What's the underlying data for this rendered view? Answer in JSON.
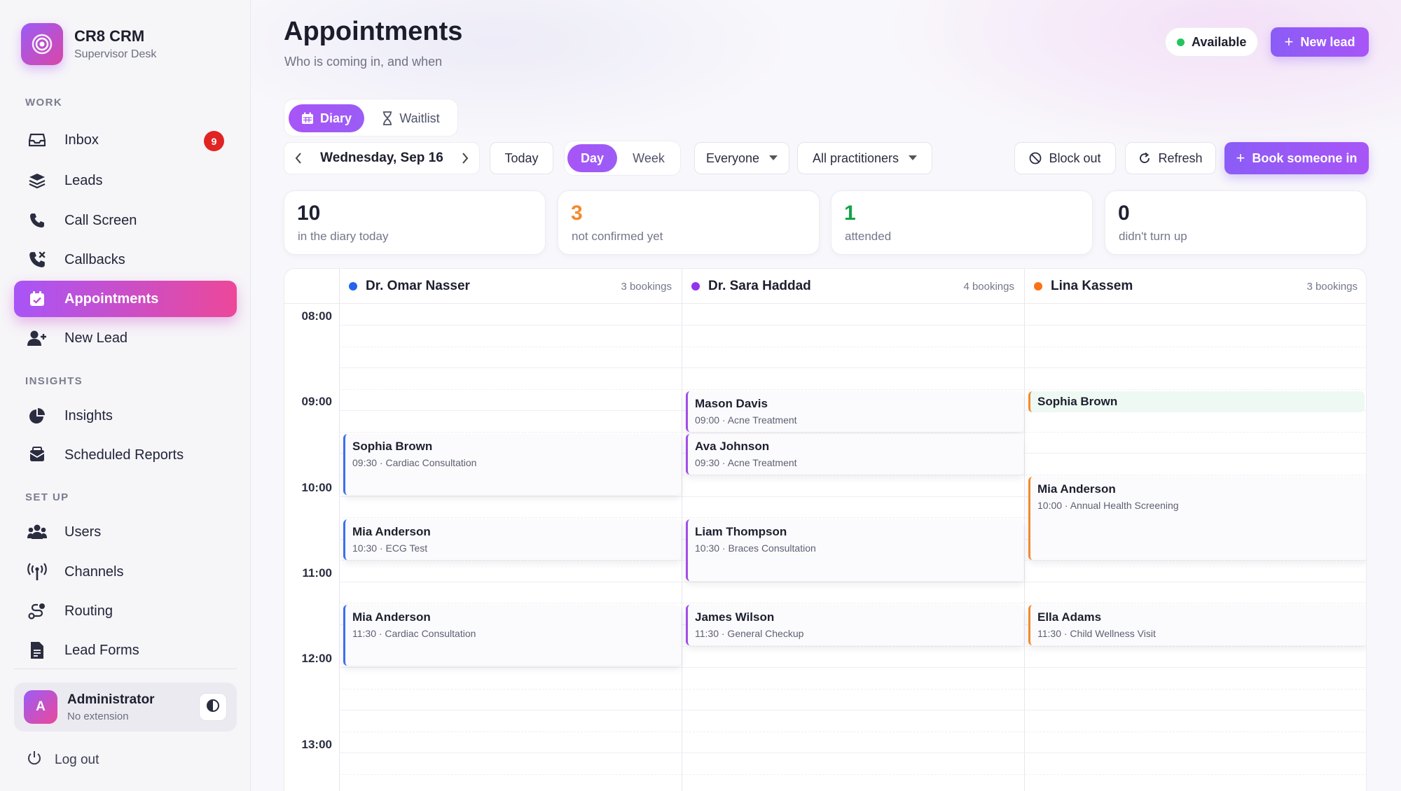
{
  "brand": {
    "name": "CR8 CRM",
    "subtitle": "Supervisor Desk"
  },
  "sidebar": {
    "sections": {
      "work": "WORK",
      "insights": "INSIGHTS",
      "setup": "SET UP"
    },
    "items": {
      "inbox": {
        "label": "Inbox",
        "badge": "9"
      },
      "leads": {
        "label": "Leads"
      },
      "call_screen": {
        "label": "Call Screen"
      },
      "callbacks": {
        "label": "Callbacks"
      },
      "appointments": {
        "label": "Appointments"
      },
      "new_lead": {
        "label": "New Lead"
      },
      "insights": {
        "label": "Insights"
      },
      "scheduled_reports": {
        "label": "Scheduled Reports"
      },
      "users": {
        "label": "Users"
      },
      "channels": {
        "label": "Channels"
      },
      "routing": {
        "label": "Routing"
      },
      "lead_forms": {
        "label": "Lead Forms"
      }
    },
    "user": {
      "avatar_letter": "A",
      "name": "Administrator",
      "extension": "No extension"
    },
    "logout_label": "Log out"
  },
  "header": {
    "title": "Appointments",
    "subtitle": "Who is coming in, and when",
    "status": "Available",
    "new_lead_button": "New lead"
  },
  "view_tabs": {
    "diary": "Diary",
    "waitlist": "Waitlist"
  },
  "toolbar": {
    "date": "Wednesday, Sep 16",
    "today": "Today",
    "day": "Day",
    "week": "Week",
    "filter_people": "Everyone",
    "filter_practitioners": "All practitioners",
    "block_out": "Block out",
    "refresh": "Refresh",
    "book": "Book someone in"
  },
  "stats": [
    {
      "value": "10",
      "label": "in the diary today",
      "color": "#1d1f2e"
    },
    {
      "value": "3",
      "label": "not confirmed yet",
      "color": "#f28a2e"
    },
    {
      "value": "1",
      "label": "attended",
      "color": "#16a34a"
    },
    {
      "value": "0",
      "label": "didn't turn up",
      "color": "#1d1f2e"
    }
  ],
  "calendar": {
    "times": [
      "08:00",
      "09:00",
      "10:00",
      "11:00",
      "12:00",
      "13:00"
    ],
    "columns": [
      {
        "name": "Dr. Omar Nasser",
        "count": "3 bookings",
        "color": "#2563eb"
      },
      {
        "name": "Dr. Sara Haddad",
        "count": "4 bookings",
        "color": "#9333ea"
      },
      {
        "name": "Lina Kassem",
        "count": "3 bookings",
        "color": "#f97316"
      }
    ],
    "appointments": {
      "omar_1": {
        "name": "Sophia Brown",
        "info": "09:30 · Cardiac Consultation"
      },
      "omar_2": {
        "name": "Mia Anderson",
        "info": "10:30 · ECG Test"
      },
      "omar_3": {
        "name": "Mia Anderson",
        "info": "11:30 · Cardiac Consultation"
      },
      "sara_1": {
        "name": "Mason Davis",
        "info": "09:00 · Acne Treatment"
      },
      "sara_2": {
        "name": "Ava Johnson",
        "info": "09:30 · Acne Treatment"
      },
      "sara_3": {
        "name": "Liam Thompson",
        "info": "10:30 · Braces Consultation"
      },
      "sara_4": {
        "name": "James Wilson",
        "info": "11:30 · General Checkup"
      },
      "lina_1": {
        "name": "Sophia Brown",
        "info": ""
      },
      "lina_2": {
        "name": "Mia Anderson",
        "info": "10:00 · Annual Health Screening"
      },
      "lina_3": {
        "name": "Ella Adams",
        "info": "11:30 · Child Wellness Visit"
      }
    }
  },
  "icons": {
    "inbox": "inbox-icon",
    "leads": "layers-icon",
    "call_screen": "phone-icon",
    "callbacks": "phone-missed-icon",
    "appointments": "calendar-check-icon",
    "new_lead": "user-plus-icon",
    "insights": "pie-chart-icon",
    "scheduled_reports": "mail-icon",
    "users": "users-icon",
    "channels": "antenna-icon",
    "routing": "route-icon",
    "lead_forms": "document-icon",
    "theme": "contrast-icon",
    "logout": "power-icon"
  }
}
